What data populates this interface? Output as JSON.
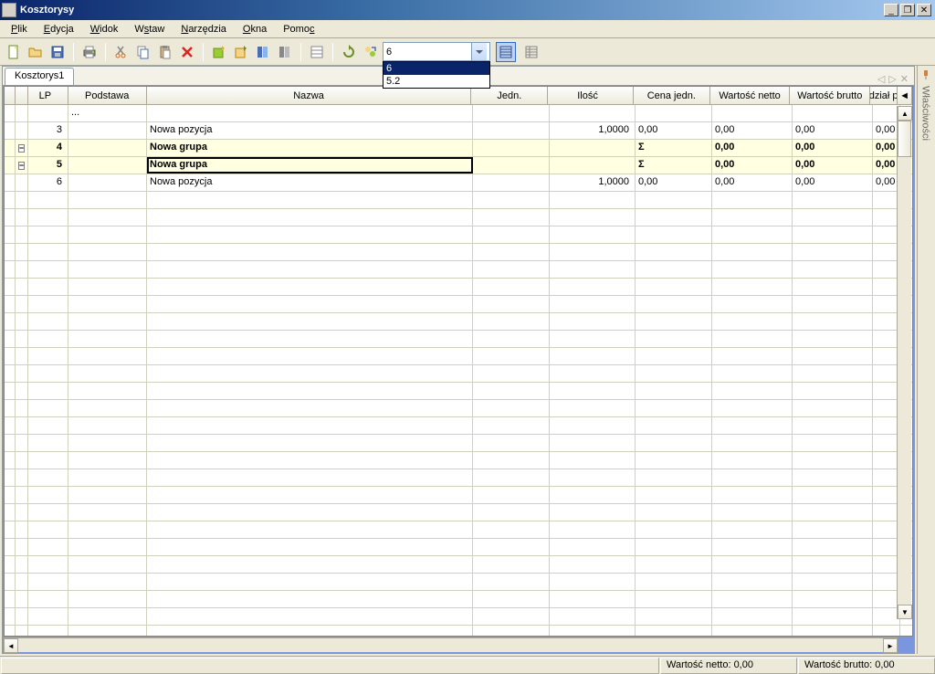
{
  "window": {
    "title": "Kosztorysy"
  },
  "menu": {
    "plik": "Plik",
    "edycja": "Edycja",
    "widok": "Widok",
    "wstaw": "Wstaw",
    "narzedzia": "Narzędzia",
    "okna": "Okna",
    "pomoc": "Pomoc"
  },
  "toolbar": {
    "combo_value": "6",
    "dropdown": {
      "opt1": "6",
      "opt2": "5.2"
    }
  },
  "tabs": {
    "tab1": "Kosztorys1"
  },
  "grid": {
    "headers": {
      "lp": "LP",
      "podstawa": "Podstawa",
      "nazwa": "Nazwa",
      "jedn": "Jedn.",
      "ilosc": "Ilość",
      "cenaj": "Cena jedn.",
      "wn": "Wartość netto",
      "wb": "Wartość brutto",
      "dzial": "dział p"
    },
    "rows": {
      "r0": {
        "lp": "",
        "podstawa": "...",
        "nazwa": "",
        "jedn": "",
        "ilosc": "",
        "cenaj": "",
        "wn": "",
        "wb": "",
        "dzial": ""
      },
      "r1": {
        "lp": "3",
        "podstawa": "",
        "nazwa": "Nowa pozycja",
        "jedn": "",
        "ilosc": "1,0000",
        "cenaj": "0,00",
        "wn": "0,00",
        "wb": "0,00",
        "dzial": "0,00"
      },
      "r2": {
        "lp": "4",
        "podstawa": "",
        "nazwa": "Nowa grupa",
        "jedn": "",
        "ilosc": "",
        "cenaj": "Σ",
        "wn": "0,00",
        "wb": "0,00",
        "dzial": "0,00"
      },
      "r3": {
        "lp": "5",
        "podstawa": "",
        "nazwa": "Nowa grupa",
        "jedn": "",
        "ilosc": "",
        "cenaj": "Σ",
        "wn": "0,00",
        "wb": "0,00",
        "dzial": "0,00"
      },
      "r4": {
        "lp": "6",
        "podstawa": "",
        "nazwa": "Nowa pozycja",
        "jedn": "",
        "ilosc": "1,0000",
        "cenaj": "0,00",
        "wn": "0,00",
        "wb": "0,00",
        "dzial": "0,00"
      }
    }
  },
  "side_panel": {
    "label": "Właściwości"
  },
  "status": {
    "wn": "Wartość netto: 0,00",
    "wb": "Wartość brutto: 0,00"
  }
}
